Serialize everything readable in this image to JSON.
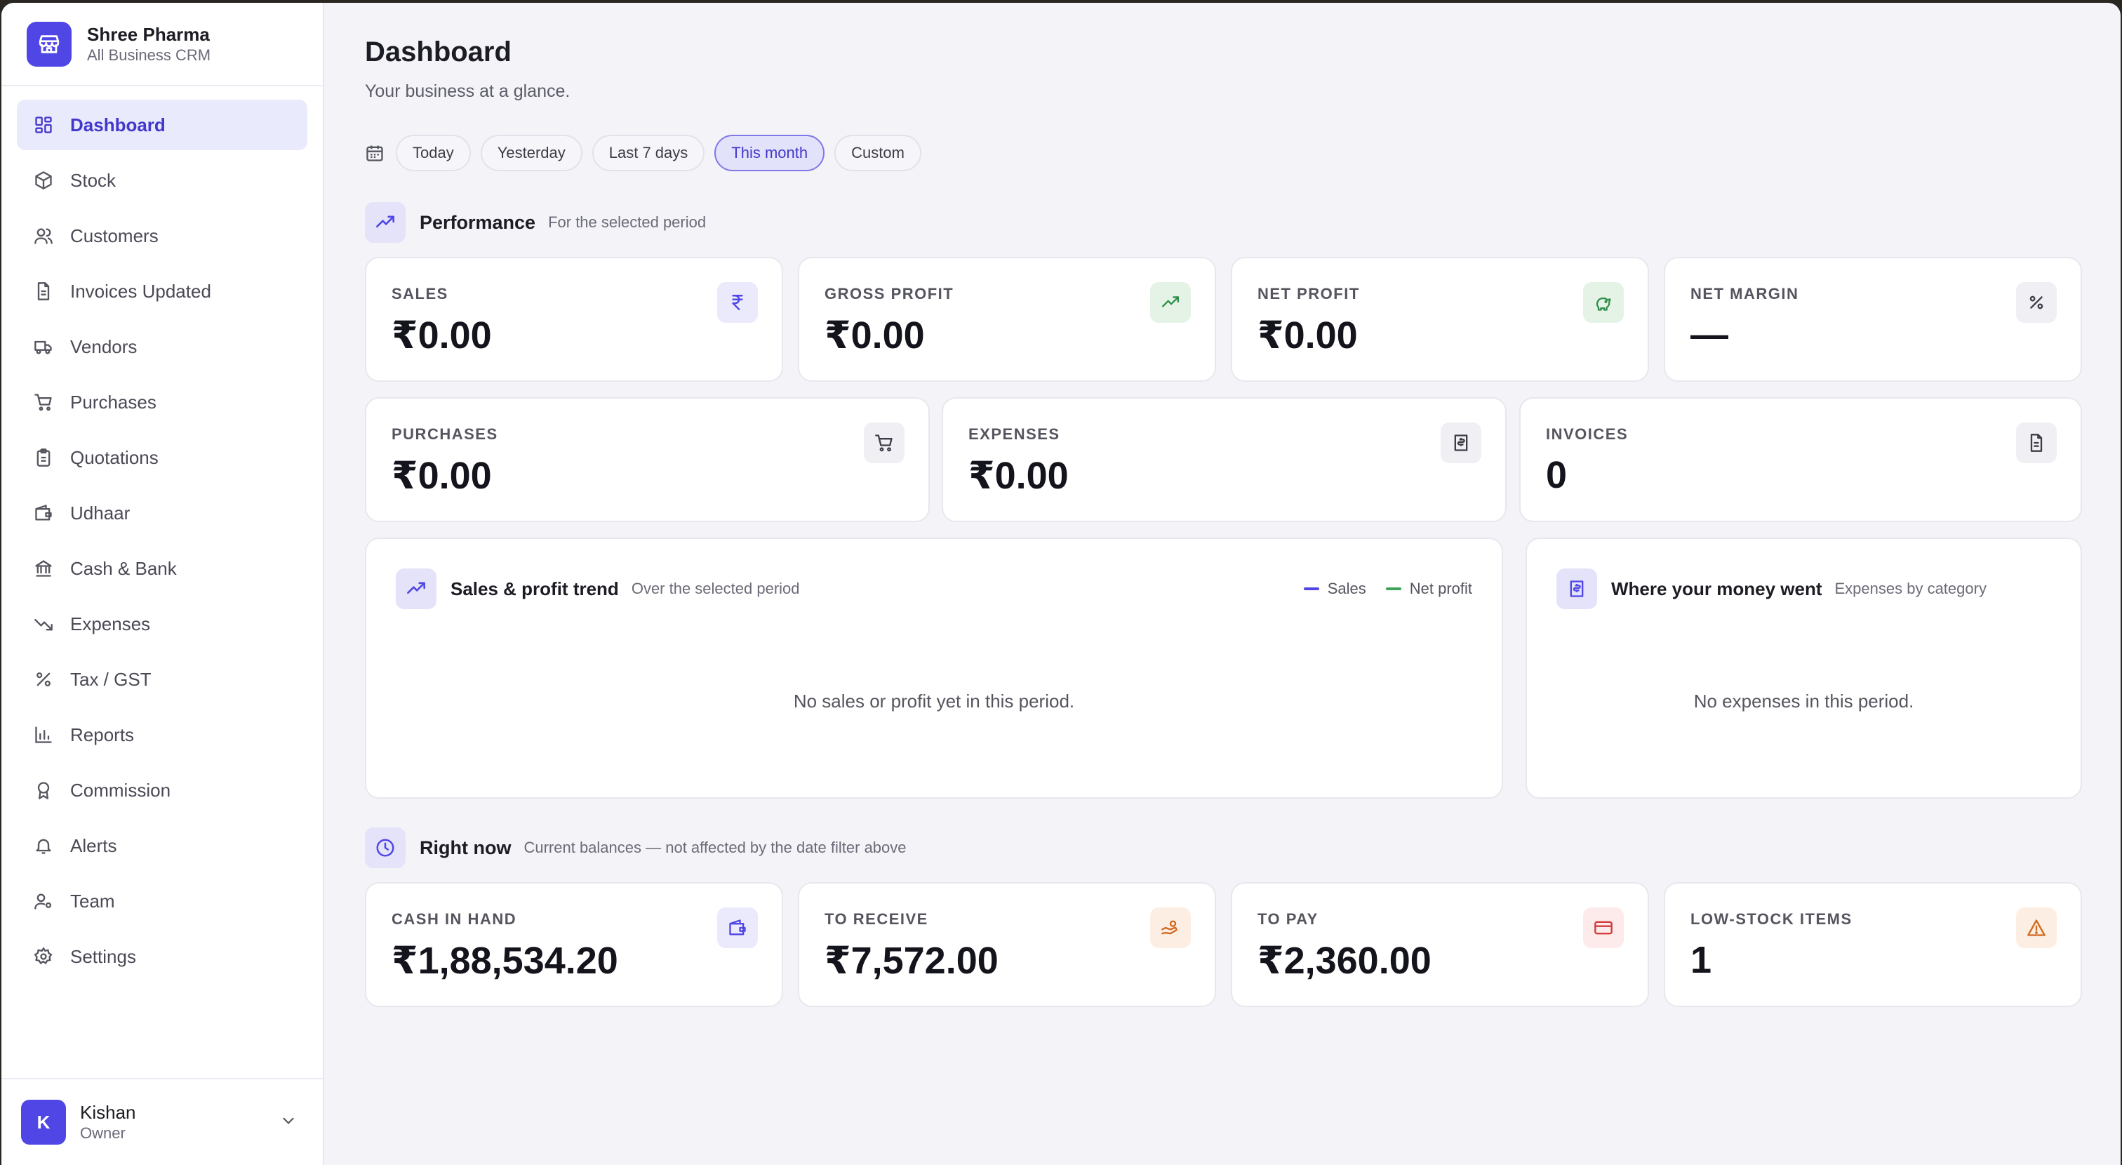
{
  "brand": {
    "name": "Shree Pharma",
    "subtitle": "All Business CRM"
  },
  "sidebar": {
    "items": [
      {
        "label": "Dashboard",
        "icon": "dashboard-icon",
        "active": true
      },
      {
        "label": "Stock",
        "icon": "box-icon"
      },
      {
        "label": "Customers",
        "icon": "users-icon"
      },
      {
        "label": "Invoices Updated",
        "icon": "file-icon"
      },
      {
        "label": "Vendors",
        "icon": "truck-icon"
      },
      {
        "label": "Purchases",
        "icon": "cart-icon"
      },
      {
        "label": "Quotations",
        "icon": "clipboard-icon"
      },
      {
        "label": "Udhaar",
        "icon": "wallet-icon"
      },
      {
        "label": "Cash & Bank",
        "icon": "bank-icon"
      },
      {
        "label": "Expenses",
        "icon": "trending-down-icon"
      },
      {
        "label": "Tax / GST",
        "icon": "percent-icon"
      },
      {
        "label": "Reports",
        "icon": "bar-chart-icon"
      },
      {
        "label": "Commission",
        "icon": "award-icon"
      },
      {
        "label": "Alerts",
        "icon": "bell-icon"
      },
      {
        "label": "Team",
        "icon": "user-cog-icon"
      },
      {
        "label": "Settings",
        "icon": "gear-icon"
      }
    ]
  },
  "user": {
    "initial": "K",
    "name": "Kishan",
    "role": "Owner"
  },
  "header": {
    "title": "Dashboard",
    "subtitle": "Your business at a glance."
  },
  "filters": {
    "options": [
      "Today",
      "Yesterday",
      "Last 7 days",
      "This month",
      "Custom"
    ],
    "selected": "This month"
  },
  "performance": {
    "title": "Performance",
    "subtitle": "For the selected period",
    "cards": [
      {
        "label": "SALES",
        "value": "₹0.00",
        "icon": "rupee-icon"
      },
      {
        "label": "GROSS PROFIT",
        "value": "₹0.00",
        "icon": "trending-up-icon"
      },
      {
        "label": "NET PROFIT",
        "value": "₹0.00",
        "icon": "piggy-bank-icon"
      },
      {
        "label": "NET MARGIN",
        "value": "—",
        "icon": "percent-icon"
      },
      {
        "label": "PURCHASES",
        "value": "₹0.00",
        "icon": "cart-icon"
      },
      {
        "label": "EXPENSES",
        "value": "₹0.00",
        "icon": "receipt-icon"
      },
      {
        "label": "INVOICES",
        "value": "0",
        "icon": "file-icon"
      }
    ]
  },
  "trend": {
    "title": "Sales & profit trend",
    "subtitle": "Over the selected period",
    "legend": [
      "Sales",
      "Net profit"
    ],
    "empty": "No sales or profit yet in this period."
  },
  "money": {
    "title": "Where your money went",
    "subtitle": "Expenses by category",
    "empty": "No expenses in this period."
  },
  "right_now": {
    "title": "Right now",
    "subtitle": "Current balances — not affected by the date filter above",
    "cards": [
      {
        "label": "CASH IN HAND",
        "value": "₹1,88,534.20",
        "icon": "wallet-icon"
      },
      {
        "label": "TO RECEIVE",
        "value": "₹7,572.00",
        "icon": "hand-coins-icon"
      },
      {
        "label": "TO PAY",
        "value": "₹2,360.00",
        "icon": "credit-card-icon"
      },
      {
        "label": "LOW-STOCK ITEMS",
        "value": "1",
        "icon": "warning-icon"
      }
    ]
  },
  "colors": {
    "accent": "#4f46e5",
    "sales_line": "#4f46e5",
    "net_profit_line": "#3ea35a",
    "green_icon": "#2f8f4a",
    "orange_icon": "#d2691e",
    "red_icon": "#d33b3b"
  }
}
